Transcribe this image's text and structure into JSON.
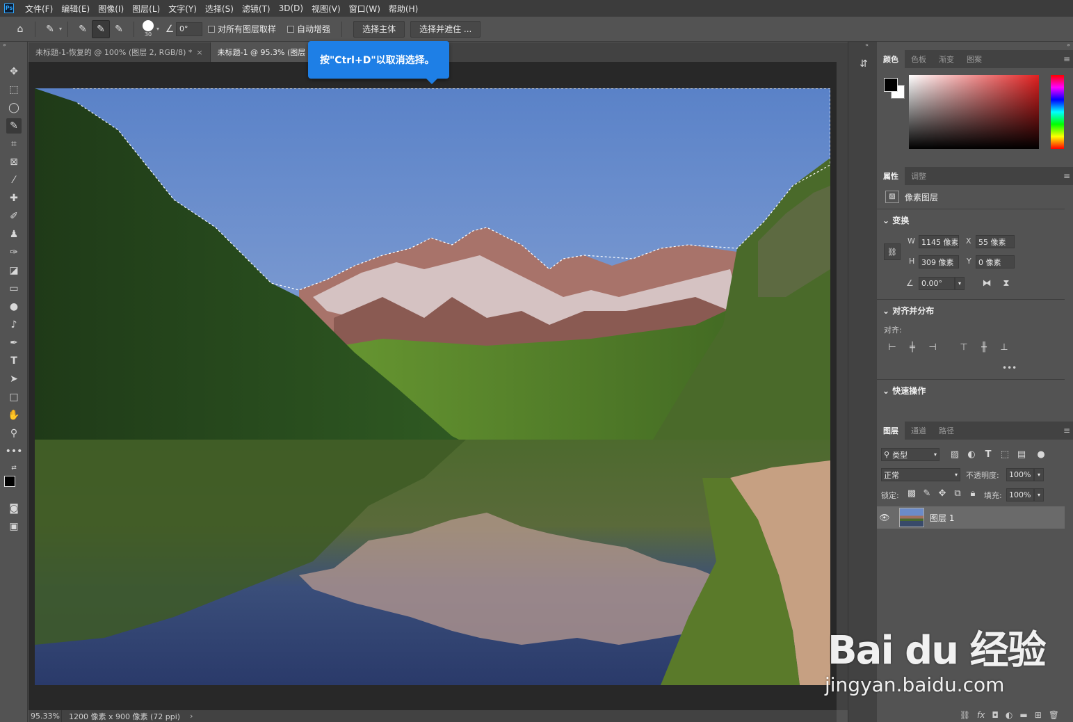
{
  "menubar": {
    "logo": "Ps",
    "items": [
      "文件(F)",
      "编辑(E)",
      "图像(I)",
      "图层(L)",
      "文字(Y)",
      "选择(S)",
      "滤镜(T)",
      "3D(D)",
      "视图(V)",
      "窗口(W)",
      "帮助(H)"
    ]
  },
  "optionsbar": {
    "brush_size": "30",
    "angle": "0°",
    "sample_all_layers": "对所有图层取样",
    "auto_enhance": "自动增强",
    "select_subject": "选择主体",
    "select_and_mask": "选择并遮住 ..."
  },
  "tabs": [
    {
      "label": "未标题-1-恢复的 @ 100% (图层 2, RGB/8) *",
      "close": "×"
    },
    {
      "label": "未标题-1 @ 95.3% (图层",
      "close": ""
    }
  ],
  "tooltip": {
    "text": "按\"Ctrl+D\"以取消选择。"
  },
  "statusbar": {
    "zoom": "95.33%",
    "doc_size": "1200 像素 x 900 像素 (72 ppi)",
    "arrow": "›"
  },
  "color_panel": {
    "tabs": [
      "颜色",
      "色板",
      "渐变",
      "图案"
    ],
    "fg_color": "#000000",
    "bg_color": "#ffffff"
  },
  "properties_panel": {
    "tabs": [
      "属性",
      "调整"
    ],
    "layer_type": "像素图层",
    "transform_title": "变换",
    "w_label": "W",
    "w_value": "1145 像素",
    "h_label": "H",
    "h_value": "309 像素",
    "x_label": "X",
    "x_value": "55 像素",
    "y_label": "Y",
    "y_value": "0 像素",
    "angle_value": "0.00°",
    "align_title": "对齐并分布",
    "align_label": "对齐:",
    "more": "•••",
    "quick_actions_title": "快速操作"
  },
  "layers_panel": {
    "tabs": [
      "图层",
      "通道",
      "路径"
    ],
    "filter_kind": "类型",
    "blend_mode": "正常",
    "opacity_label": "不透明度:",
    "opacity_value": "100%",
    "lock_label": "锁定:",
    "fill_label": "填充:",
    "fill_value": "100%",
    "layers": [
      {
        "name": "图层 1",
        "visible": true
      }
    ]
  },
  "watermark": {
    "brand": "Bai du 经验",
    "url": "jingyan.baidu.com"
  }
}
